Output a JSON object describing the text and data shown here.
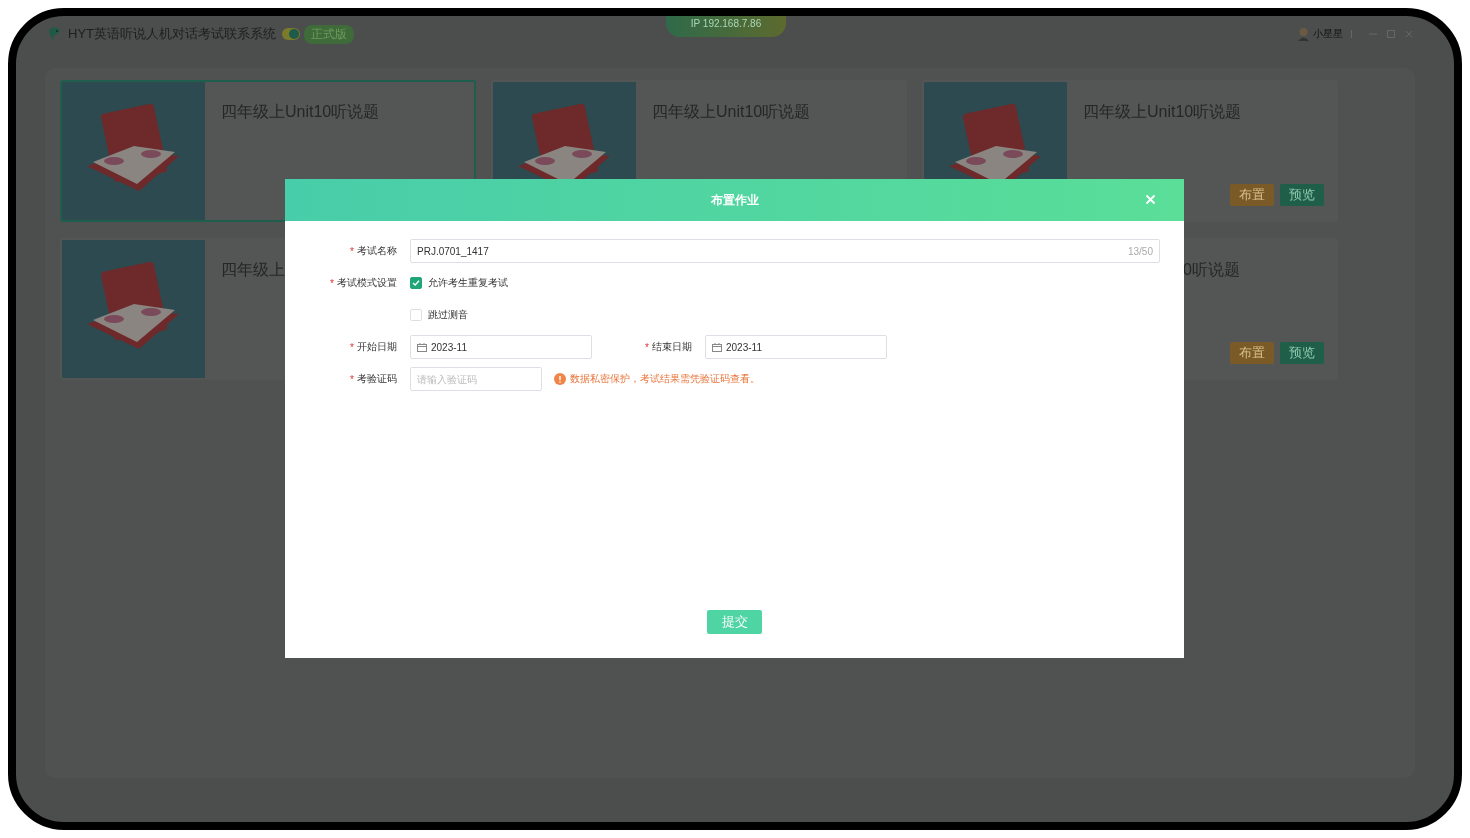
{
  "window": {
    "title": "HYT英语听说人机对话考试联系系统",
    "env_switch": {
      "on": true
    },
    "edition_badge": "正式版",
    "ip": "IP 192.168.7.86",
    "user": "小星星"
  },
  "cards": [
    {
      "title": "四年级上Unit10听说题",
      "selected": true
    },
    {
      "title": "四年级上Unit10听说题",
      "selected": false
    },
    {
      "title": "四年级上Unit10听说题",
      "selected": false,
      "buttons": [
        "布置",
        "预览"
      ]
    },
    {
      "title": "四年级上",
      "selected": false
    },
    {
      "title": "0听说题",
      "selected": false,
      "buttons": [
        "布置",
        "预览"
      ]
    }
  ],
  "dialog": {
    "title": "布置作业",
    "name_field": {
      "marker": "*",
      "label": "考试名称",
      "value": "PRJ.0701_1417",
      "counter": "13/50"
    },
    "mode_field": {
      "marker": "*",
      "label": "考试模式设置",
      "options": [
        {
          "label": "允许考生重复考试",
          "checked": true
        },
        {
          "label": "跳过测音",
          "checked": false
        }
      ]
    },
    "start_date": {
      "marker": "*",
      "label": "开始日期",
      "value": "2023-11"
    },
    "end_date": {
      "marker": "*",
      "label": "结束日期",
      "value": "2023-11"
    },
    "code_field": {
      "marker": "*",
      "label": "考验证码",
      "placeholder": "请输入验证码",
      "hint": "数据私密保护，考试结果需凭验证码查看。"
    },
    "submit": "提交"
  }
}
